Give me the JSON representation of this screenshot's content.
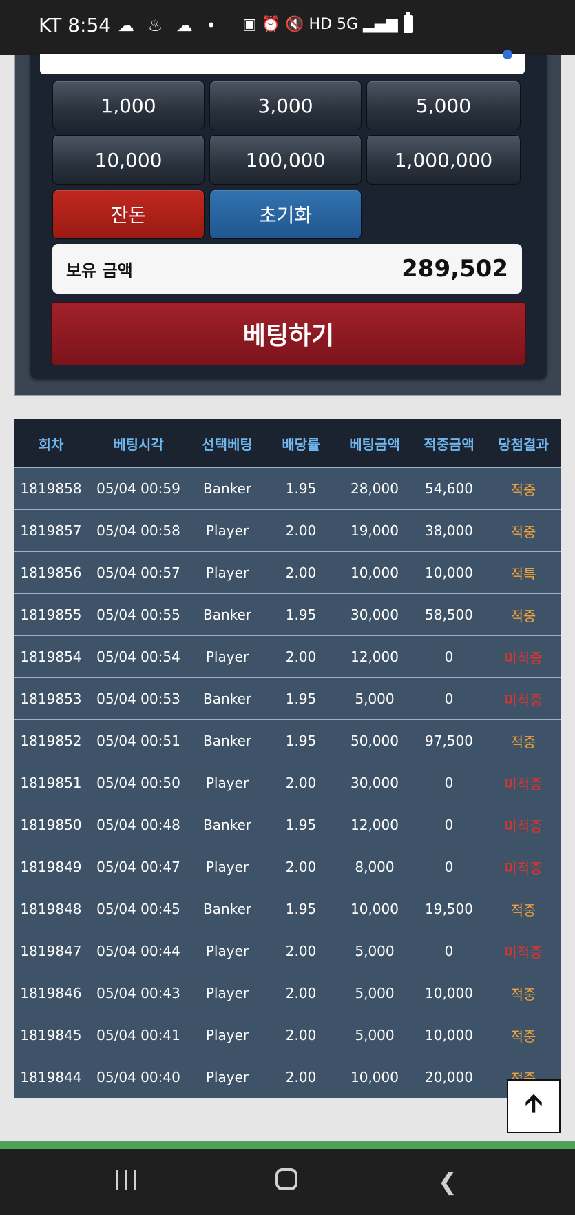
{
  "status_bar": {
    "carrier_time": "KT 8:54",
    "left_icons": "☁ ♨ ☁ •",
    "right_icons": "▣ ⏰ 🔇 HD 5G ▂▄▆"
  },
  "amount_buttons": [
    "1,000",
    "3,000",
    "5,000",
    "10,000",
    "100,000",
    "1,000,000"
  ],
  "action_buttons": {
    "change": "잔돈",
    "reset": "초기화"
  },
  "balance": {
    "label": "보유 금액",
    "value": "289,502"
  },
  "bet_button": "베팅하기",
  "table": {
    "headers": [
      "회차",
      "베팅시각",
      "선택베팅",
      "배당률",
      "베팅금액",
      "적중금액",
      "당첨결과"
    ],
    "rows": [
      [
        "1819858",
        "05/04 00:59",
        "Banker",
        "1.95",
        "28,000",
        "54,600",
        "적중"
      ],
      [
        "1819857",
        "05/04 00:58",
        "Player",
        "2.00",
        "19,000",
        "38,000",
        "적중"
      ],
      [
        "1819856",
        "05/04 00:57",
        "Player",
        "2.00",
        "10,000",
        "10,000",
        "적특"
      ],
      [
        "1819855",
        "05/04 00:55",
        "Banker",
        "1.95",
        "30,000",
        "58,500",
        "적중"
      ],
      [
        "1819854",
        "05/04 00:54",
        "Player",
        "2.00",
        "12,000",
        "0",
        "미적중"
      ],
      [
        "1819853",
        "05/04 00:53",
        "Banker",
        "1.95",
        "5,000",
        "0",
        "미적중"
      ],
      [
        "1819852",
        "05/04 00:51",
        "Banker",
        "1.95",
        "50,000",
        "97,500",
        "적중"
      ],
      [
        "1819851",
        "05/04 00:50",
        "Player",
        "2.00",
        "30,000",
        "0",
        "미적중"
      ],
      [
        "1819850",
        "05/04 00:48",
        "Banker",
        "1.95",
        "12,000",
        "0",
        "미적중"
      ],
      [
        "1819849",
        "05/04 00:47",
        "Player",
        "2.00",
        "8,000",
        "0",
        "미적중"
      ],
      [
        "1819848",
        "05/04 00:45",
        "Banker",
        "1.95",
        "10,000",
        "19,500",
        "적중"
      ],
      [
        "1819847",
        "05/04 00:44",
        "Player",
        "2.00",
        "5,000",
        "0",
        "미적중"
      ],
      [
        "1819846",
        "05/04 00:43",
        "Player",
        "2.00",
        "5,000",
        "10,000",
        "적중"
      ],
      [
        "1819845",
        "05/04 00:41",
        "Player",
        "2.00",
        "5,000",
        "10,000",
        "적중"
      ],
      [
        "1819844",
        "05/04 00:40",
        "Player",
        "2.00",
        "10,000",
        "20,000",
        "적중"
      ]
    ]
  },
  "colors": {
    "win": "#f0a23c",
    "lose": "#e5332b",
    "header_text": "#6fb7ee"
  },
  "icons": {
    "scroll_top": "arrow-up-icon"
  }
}
